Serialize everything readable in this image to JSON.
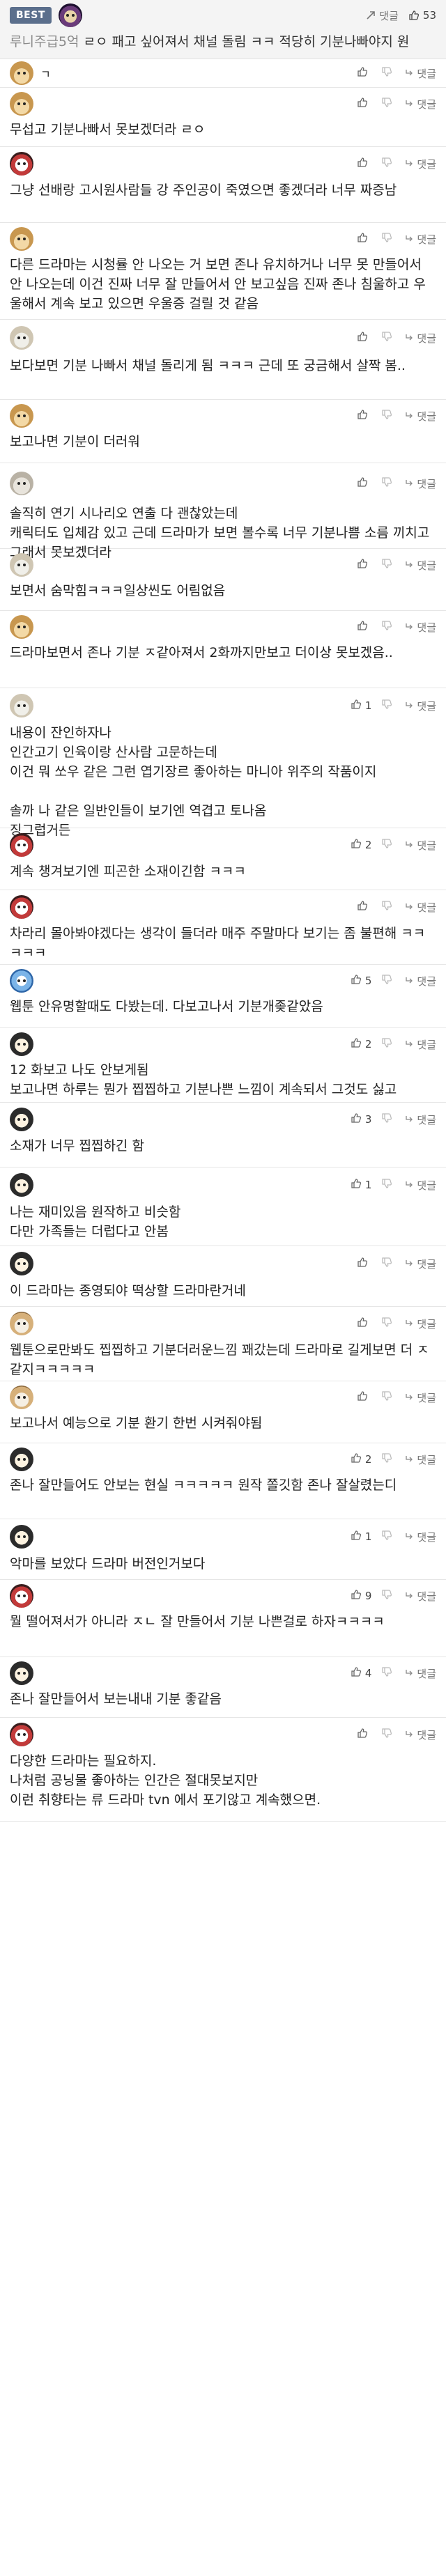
{
  "best": {
    "badge": "BEST",
    "reply_label": "댓글",
    "likes": "53",
    "nickname": "루니주급5억",
    "text": "ㄹㅇ 패고 싶어져서 채널 돌림 ㅋㅋ 적당히 기분나빠야지 원"
  },
  "labels": {
    "reply": "댓글"
  },
  "icons": {
    "like": "thumbs-up-icon",
    "dislike": "thumbs-down-icon",
    "reply": "reply-arrow-icon"
  },
  "colors": {
    "badge": "#5b6f8c",
    "border": "#e6e6e6",
    "muted": "#888888"
  },
  "comments": [
    {
      "text": "ㄱ",
      "likes": ""
    },
    {
      "text": "무섭고 기분나빠서 못보겠더라 ㄹㅇ",
      "likes": ""
    },
    {
      "text": "그냥 선배랑 고시원사람들 강 주인공이 죽였으면 좋겠더라 너무 짜증남",
      "likes": ""
    },
    {
      "text": "다른 드라마는 시청률 안 나오는 거 보면 존나 유치하거나 너무 못 만들어서 안 나오는데 이건 진짜 너무 잘 만들어서 안 보고싶음 진짜 존나 침울하고 우울해서 계속 보고 있으면 우울증 걸릴 것 같음",
      "likes": ""
    },
    {
      "text": "보다보면 기분 나빠서 채널 돌리게 됨 ㅋㅋㅋ 근데 또 궁금해서 살짝 봄..",
      "likes": ""
    },
    {
      "text": "보고나면 기분이 더러워",
      "likes": ""
    },
    {
      "text": "솔직히 연기 시나리오 연출 다 괜찮았는데\n캐릭터도 입체감 있고 근데 드라마가 보면 볼수록 너무 기분나쁨 소름 끼치고 그래서 못보겠더라",
      "likes": ""
    },
    {
      "text": "보면서 숨막힘ㅋㅋㅋ일상씬도 어림없음",
      "likes": ""
    },
    {
      "text": "드라마보면서 존나 기분 ㅈ같아져서 2화까지만보고 더이상 못보겠음..",
      "likes": ""
    },
    {
      "text": "내용이 잔인하자나\n인간고기 인육이랑 산사람 고문하는데\n이건 뭐 쏘우 같은 그런 엽기장르 좋아하는 마니아 위주의 작품이지\n\n솔까 나 같은 일반인들이 보기엔 역겹고 토나옴\n징그럽거든",
      "likes": "1"
    },
    {
      "text": "계속 챙겨보기엔 피곤한 소재이긴함 ㅋㅋㅋ",
      "likes": "2"
    },
    {
      "text": "차라리 몰아봐야겠다는 생각이 들더라 매주 주말마다 보기는 좀 불편해 ㅋㅋㅋㅋㅋ",
      "likes": ""
    },
    {
      "text": "웹툰 안유명할때도 다봤는데. 다보고나서 기분개좆같았음",
      "likes": "5"
    },
    {
      "text": "12 화보고 나도 안보게됨\n보고나면 하루는 뭔가 찝찝하고 기분나쁜 느낌이 계속되서 그것도 싫고",
      "likes": "2"
    },
    {
      "text": "소재가 너무 찝찝하긴 함",
      "likes": "3"
    },
    {
      "text": "나는 재미있음 원작하고 비슷함\n다만 가족들는 더럽다고 안봄",
      "likes": "1"
    },
    {
      "text": "이 드라마는 종영되야 떡상할 드라마란거네",
      "likes": ""
    },
    {
      "text": "웹툰으로만봐도 찝찝하고 기분더러운느낌 꽤갔는데 드라마로 길게보면 더 ㅈ같지ㅋㅋㅋㅋㅋ",
      "likes": ""
    },
    {
      "text": "보고나서 예능으로 기분 환기 한번 시켜줘야됨",
      "likes": ""
    },
    {
      "text": "존나 잘만들어도 안보는 현실 ㅋㅋㅋㅋㅋ 원작 쫄깃함 존나 잘살렸는디",
      "likes": "2"
    },
    {
      "text": "악마를 보았다 드라마 버전인거보다",
      "likes": "1"
    },
    {
      "text": "뭘 떨어져서가 아니라 ㅈㄴ 잘 만들어서 기분 나쁜걸로 하자ㅋㅋㅋㅋ",
      "likes": "9"
    },
    {
      "text": "존나 잘만들어서 보는내내 기분 좋같음",
      "likes": "4"
    },
    {
      "text": "다양한 드라마는 필요하지.\n나처럼 공닝물 좋아하는 인간은 절대못보지만\n이런 취향타는 류 드라마 tvn 에서 포기않고 계속했으면.",
      "likes": ""
    }
  ]
}
